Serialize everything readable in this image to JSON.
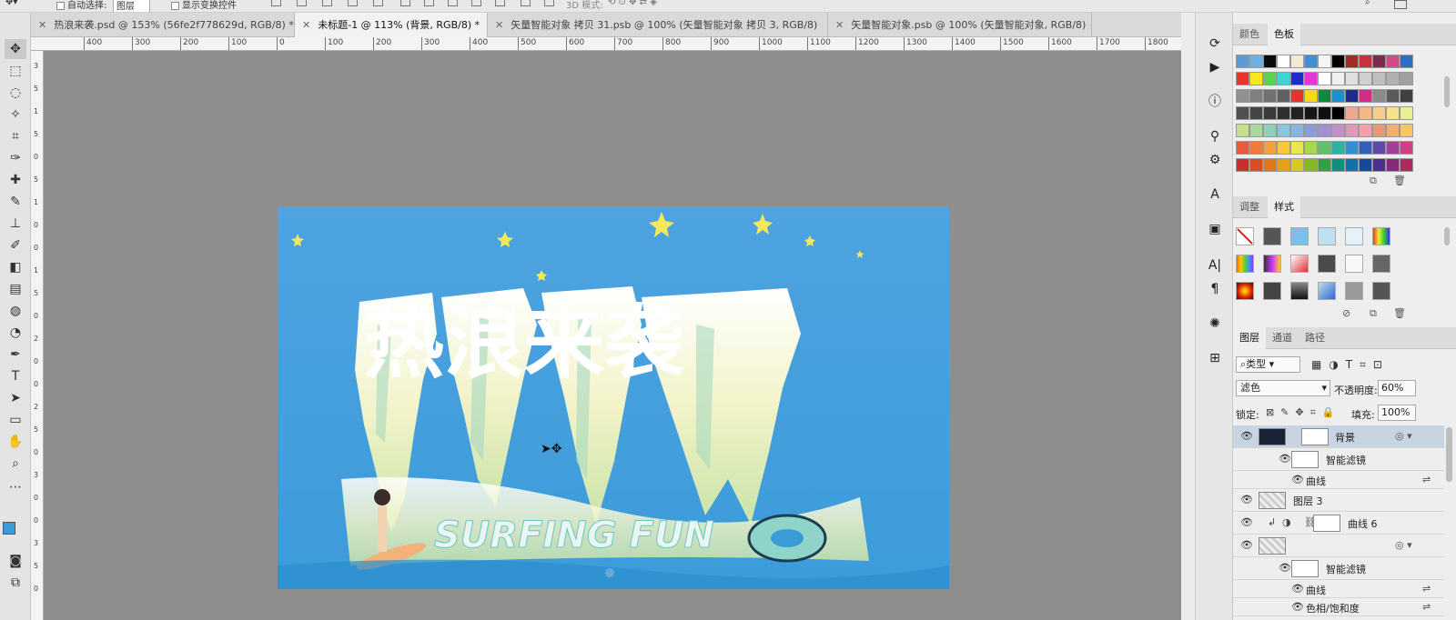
{
  "options_bar": {
    "auto_select_label": "自动选择:",
    "auto_select_value": "图层",
    "show_transform_label": "显示变换控件",
    "mode_3d_label": "3D 模式:"
  },
  "tabs": [
    {
      "label": "热浪来袭.psd @ 153% (56fe2f778629d, RGB/8) *",
      "active": false
    },
    {
      "label": "未标题-1 @ 113% (背景, RGB/8) *",
      "active": true
    },
    {
      "label": "矢量智能对象 拷贝 31.psb @ 100% (矢量智能对象 拷贝 3, RGB/8)",
      "active": false
    },
    {
      "label": "矢量智能对象.psb @ 100% (矢量智能对象, RGB/8)",
      "active": false
    }
  ],
  "ruler": {
    "h_labels": [
      "400",
      "300",
      "200",
      "100",
      "0",
      "100",
      "200",
      "300",
      "400",
      "500",
      "600",
      "700",
      "800",
      "900",
      "1000",
      "1100",
      "1200",
      "1300",
      "1400",
      "1500",
      "1600",
      "1700",
      "1800"
    ],
    "v_labels": [
      "3",
      "5",
      "1",
      "5",
      "0",
      "5",
      "1",
      "0",
      "0",
      "1",
      "5",
      "0",
      "2",
      "0",
      "0",
      "2",
      "5",
      "0",
      "3",
      "0",
      "0",
      "3",
      "5",
      "0"
    ]
  },
  "artwork": {
    "headline": "热浪来袭",
    "subtitle": "SURFING FUN"
  },
  "swatch_panel": {
    "tabs": [
      "颜色",
      "色板"
    ],
    "active": "色板",
    "rows": [
      [
        "#5b9bd5",
        "#6cb0e3",
        "#0b0b0b",
        "#ffffff",
        "#f3ead3",
        "#3f8fd4",
        "#f5f5f5",
        "#000000",
        "#a52a2a",
        "#c8323c",
        "#7a2c4c",
        "#d24c8c",
        "#2d6fc6"
      ],
      [
        "#e8352b",
        "#f6e71e",
        "#5ad24c",
        "#3fd3d6",
        "#1e2ccf",
        "#e634d6",
        "#ffffff",
        "#f0f0f0",
        "#e0e0e0",
        "#d0d0d0",
        "#c0c0c0",
        "#b0b0b0",
        "#a0a0a0"
      ],
      [
        "#909090",
        "#808080",
        "#707070",
        "#606060",
        "#e6322c",
        "#f7d81c",
        "#0f8a3c",
        "#1c8fd0",
        "#1e2a8c",
        "#d42c86",
        "#8a8a8a",
        "#5a5a5a",
        "#404040"
      ],
      [
        "#505050",
        "#454545",
        "#3a3a3a",
        "#2e2e2e",
        "#222222",
        "#161616",
        "#101010",
        "#000000",
        "#f0a88c",
        "#f4b882",
        "#f7cc8c",
        "#f8e08c",
        "#e9ef94"
      ],
      [
        "#c4e08c",
        "#a8d8a0",
        "#90d0b8",
        "#88c8d8",
        "#88b4e0",
        "#8c9cd8",
        "#a090d0",
        "#c090c8",
        "#e098b8",
        "#f0a0a8",
        "#e89878",
        "#f0b070",
        "#f4c860"
      ],
      [
        "#e85a3c",
        "#f07a3c",
        "#f4a03c",
        "#f8c83c",
        "#e8e84c",
        "#a8d84c",
        "#60c06c",
        "#30b0a0",
        "#3090d0",
        "#3060b8",
        "#6048a8",
        "#a04098",
        "#d04080"
      ],
      [
        "#c8302c",
        "#d85020",
        "#e07818",
        "#e8a018",
        "#d8c820",
        "#88b820",
        "#30a040",
        "#10907c",
        "#1070b0",
        "#18489c",
        "#483090",
        "#88287c",
        "#b02860"
      ]
    ]
  },
  "styles_panel": {
    "tabs": [
      "调整",
      "样式"
    ],
    "active": "样式"
  },
  "layers_panel": {
    "tabs": [
      "图层",
      "通道",
      "路径"
    ],
    "active": "图层",
    "filter_kind": "类型",
    "blend_mode": "滤色",
    "opacity_label": "不透明度:",
    "opacity_value": "60%",
    "lock_label": "锁定:",
    "fill_label": "填充:",
    "fill_value": "100%",
    "layers": [
      {
        "name": "背景",
        "type": "smart",
        "selected": true
      },
      {
        "name": "智能滤镜",
        "type": "filter-mask"
      },
      {
        "name": "曲线",
        "type": "filter"
      },
      {
        "name": "图层 3",
        "type": "pixel"
      },
      {
        "name": "曲线 6",
        "type": "adjustment"
      },
      {
        "name": "",
        "type": "smart"
      },
      {
        "name": "智能滤镜",
        "type": "filter-mask"
      },
      {
        "name": "曲线",
        "type": "filter"
      },
      {
        "name": "色相/饱和度",
        "type": "filter"
      }
    ]
  }
}
